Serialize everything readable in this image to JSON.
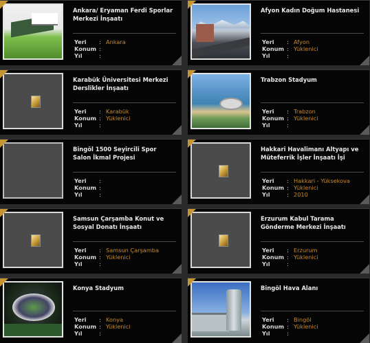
{
  "labels": {
    "location": "Yeri",
    "position": "Konum",
    "year": "Yıl",
    "sep": ":"
  },
  "colors": {
    "accent": "#c9892a",
    "card_bg": "#050505",
    "page_bg": "#2a2a2a"
  },
  "projects": [
    {
      "title": "Ankara/ Eryaman Ferdi Sporlar Merkezi İnşaatı",
      "location": "Ankara",
      "position": "",
      "year": "",
      "thumb": "photo-sports-complex"
    },
    {
      "title": "Afyon Kadın Doğum Hastanesi",
      "location": "Afyon",
      "position": "Yüklenici",
      "year": "",
      "thumb": "photo-hospital"
    },
    {
      "title": "Karabük Üniversitesi Merkezi Derslikler İnşaatı",
      "location": "Karabük",
      "position": "Yüklenici",
      "year": "",
      "thumb": "placeholder-icon"
    },
    {
      "title": "Trabzon Stadyum",
      "location": "Trabzon",
      "position": "Yüklenici",
      "year": "",
      "thumb": "photo-stadium-coast"
    },
    {
      "title": "Bingöl 1500 Seyircili Spor Salon İkmal Projesi",
      "location": "",
      "position": "",
      "year": "",
      "thumb": "blank"
    },
    {
      "title": "Hakkari Havalimanı Altyapı ve Müteferrik İşler İnşaatı İşi",
      "location": "Hakkari - Yüksekova",
      "position": "Yüklenici",
      "year": "2010",
      "thumb": "placeholder-icon"
    },
    {
      "title": "Samsun Çarşamba Konut ve Sosyal Donatı İnşaatı",
      "location": "Samsun Çarşamba",
      "position": "Yüklenici",
      "year": "",
      "thumb": "placeholder-icon"
    },
    {
      "title": "Erzurum Kabul Tarama Gönderme Merkezi İnşaatı",
      "location": "Erzurum",
      "position": "Yüklenici",
      "year": "",
      "thumb": "placeholder-icon"
    },
    {
      "title": "Konya Stadyum",
      "location": "Konya",
      "position": "Yüklenici",
      "year": "",
      "thumb": "photo-stadium-night"
    },
    {
      "title": "Bingöl Hava Alanı",
      "location": "Bingöl",
      "position": "Yüklenici",
      "year": "",
      "thumb": "photo-airport"
    }
  ]
}
